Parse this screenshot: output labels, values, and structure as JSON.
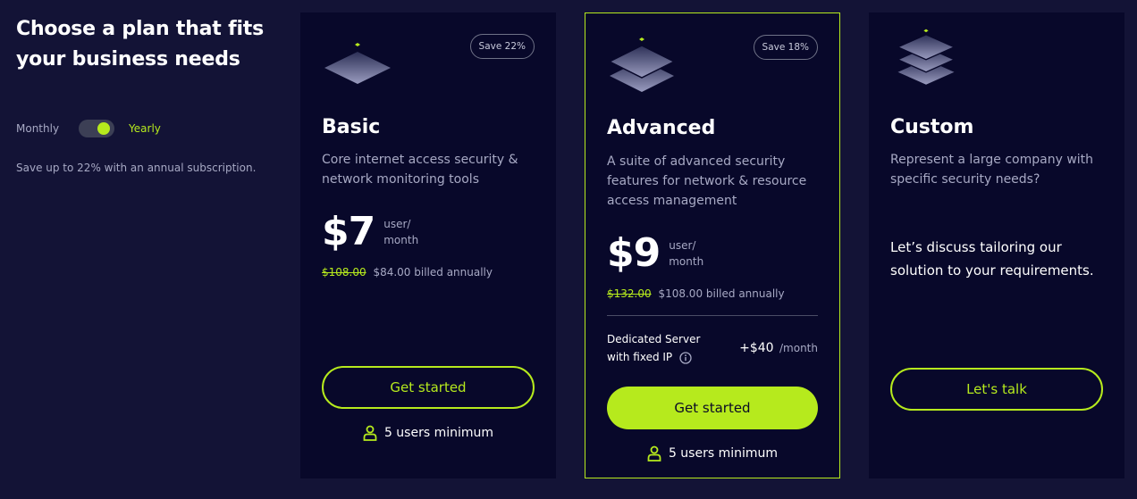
{
  "intro": {
    "title_line1": "Choose a plan that fits",
    "title_line2": "your business needs",
    "toggle": {
      "off_label": "Monthly",
      "on_label": "Yearly",
      "state": "yearly"
    },
    "save_note": "Save up to 22% with an annual subscription."
  },
  "plans": {
    "basic": {
      "icon": "layers-1-icon",
      "badge": "Save 22%",
      "name": "Basic",
      "description": "Core internet access security & network monitoring tools",
      "price": "$7",
      "unit_line1": "user/",
      "unit_line2": "month",
      "old_price": "$108.00",
      "billed": "$84.00 billed annually",
      "cta": "Get started",
      "min_users": "5 users minimum"
    },
    "advanced": {
      "icon": "layers-2-icon",
      "badge": "Save 18%",
      "name": "Advanced",
      "description": "A suite of advanced security features for network & resource access management",
      "price": "$9",
      "unit_line1": "user/",
      "unit_line2": "month",
      "old_price": "$132.00",
      "billed": "$108.00 billed annually",
      "addon_line1": "Dedicated Server",
      "addon_line2": "with fixed IP",
      "addon_price": "+$40",
      "addon_period": "/month",
      "cta": "Get started",
      "min_users": "5 users minimum"
    },
    "custom": {
      "icon": "layers-3-icon",
      "name": "Custom",
      "description": "Represent a large company with specific security needs?",
      "pitch": "Let’s discuss tailoring our solution to your requirements.",
      "cta": "Let's talk"
    }
  },
  "colors": {
    "background": "#131336",
    "card": "#08082a",
    "accent": "#b6ea1d",
    "muted_text": "#a7a9c4"
  }
}
